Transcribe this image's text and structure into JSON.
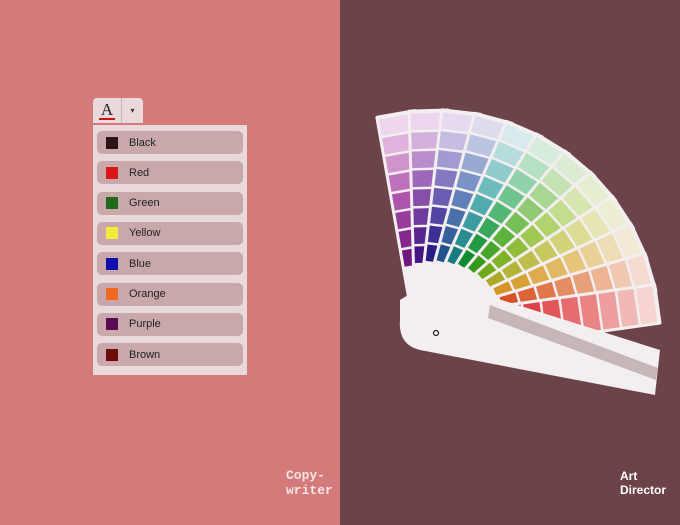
{
  "left_panel": {
    "background": "#d47a7a",
    "font_color_button": {
      "glyph": "A",
      "underline_color": "#d01010",
      "caret": "▾",
      "icon": "font-color-icon"
    },
    "color_menu": {
      "items": [
        {
          "label": "Black",
          "color": "#2a1416"
        },
        {
          "label": "Red",
          "color": "#d81818"
        },
        {
          "label": "Green",
          "color": "#1e6a1a"
        },
        {
          "label": "Yellow",
          "color": "#f4ea3a"
        },
        {
          "label": "Blue",
          "color": "#1010b0"
        },
        {
          "label": "Orange",
          "color": "#f06a20"
        },
        {
          "label": "Purple",
          "color": "#5a0a50"
        },
        {
          "label": "Brown",
          "color": "#6e0c0c"
        }
      ]
    },
    "caption": [
      "Copy-",
      "writer"
    ]
  },
  "right_panel": {
    "background": "#6c4349",
    "caption": [
      "Art",
      "Director"
    ],
    "swatch_fan": {
      "strips": [
        [
          "#f0d6ec",
          "#e2b2dc",
          "#d094cc",
          "#bf72bc",
          "#ad54ac",
          "#983c9c",
          "#84288e",
          "#6e1880"
        ],
        [
          "#ecd6ee",
          "#d4b0dc",
          "#b98ccb",
          "#9e68ba",
          "#8650aa",
          "#6e3a9c",
          "#58268e",
          "#441480"
        ],
        [
          "#e6daf0",
          "#c8bce2",
          "#a49ad2",
          "#8478c0",
          "#6a5cb0",
          "#5244a2",
          "#3c3092",
          "#2a1e84"
        ],
        [
          "#dcdcec",
          "#bcc4e0",
          "#98aad2",
          "#7a92c4",
          "#6080b8",
          "#4a70aa",
          "#36609c",
          "#24528e"
        ],
        [
          "#d8eaec",
          "#b6dcdc",
          "#90cccc",
          "#6cbcbc",
          "#50acac",
          "#3c9ca0",
          "#288c90",
          "#167c80"
        ],
        [
          "#d6ecdc",
          "#b4e0c4",
          "#92d2aa",
          "#70c48e",
          "#52b674",
          "#38a85a",
          "#229a44",
          "#0e8c30"
        ],
        [
          "#dcecd4",
          "#c4e2b4",
          "#aad694",
          "#90ca74",
          "#76be56",
          "#5eb23e",
          "#48a62a",
          "#349a18"
        ],
        [
          "#e6eed2",
          "#d6e6b0",
          "#c4dc8e",
          "#b2d270",
          "#a0c854",
          "#90be3c",
          "#80b428",
          "#70aa18"
        ],
        [
          "#eeeed4",
          "#e6e6b4",
          "#dcdc96",
          "#d2d27a",
          "#c8c862",
          "#bebe4c",
          "#b4b438",
          "#aaaa26"
        ],
        [
          "#f2ead4",
          "#eedcb4",
          "#ead096",
          "#e6c47a",
          "#e2b862",
          "#deac4c",
          "#daa038",
          "#d69426"
        ],
        [
          "#f4ddd0",
          "#f0c8b0",
          "#ecb494",
          "#e8a07a",
          "#e48c62",
          "#e0784c",
          "#dc6438",
          "#d85026"
        ],
        [
          "#f6d4d2",
          "#f2b8b6",
          "#ee9e9c",
          "#ea8484",
          "#e66c6e",
          "#e2565a",
          "#de4048",
          "#d82a36"
        ]
      ]
    }
  }
}
